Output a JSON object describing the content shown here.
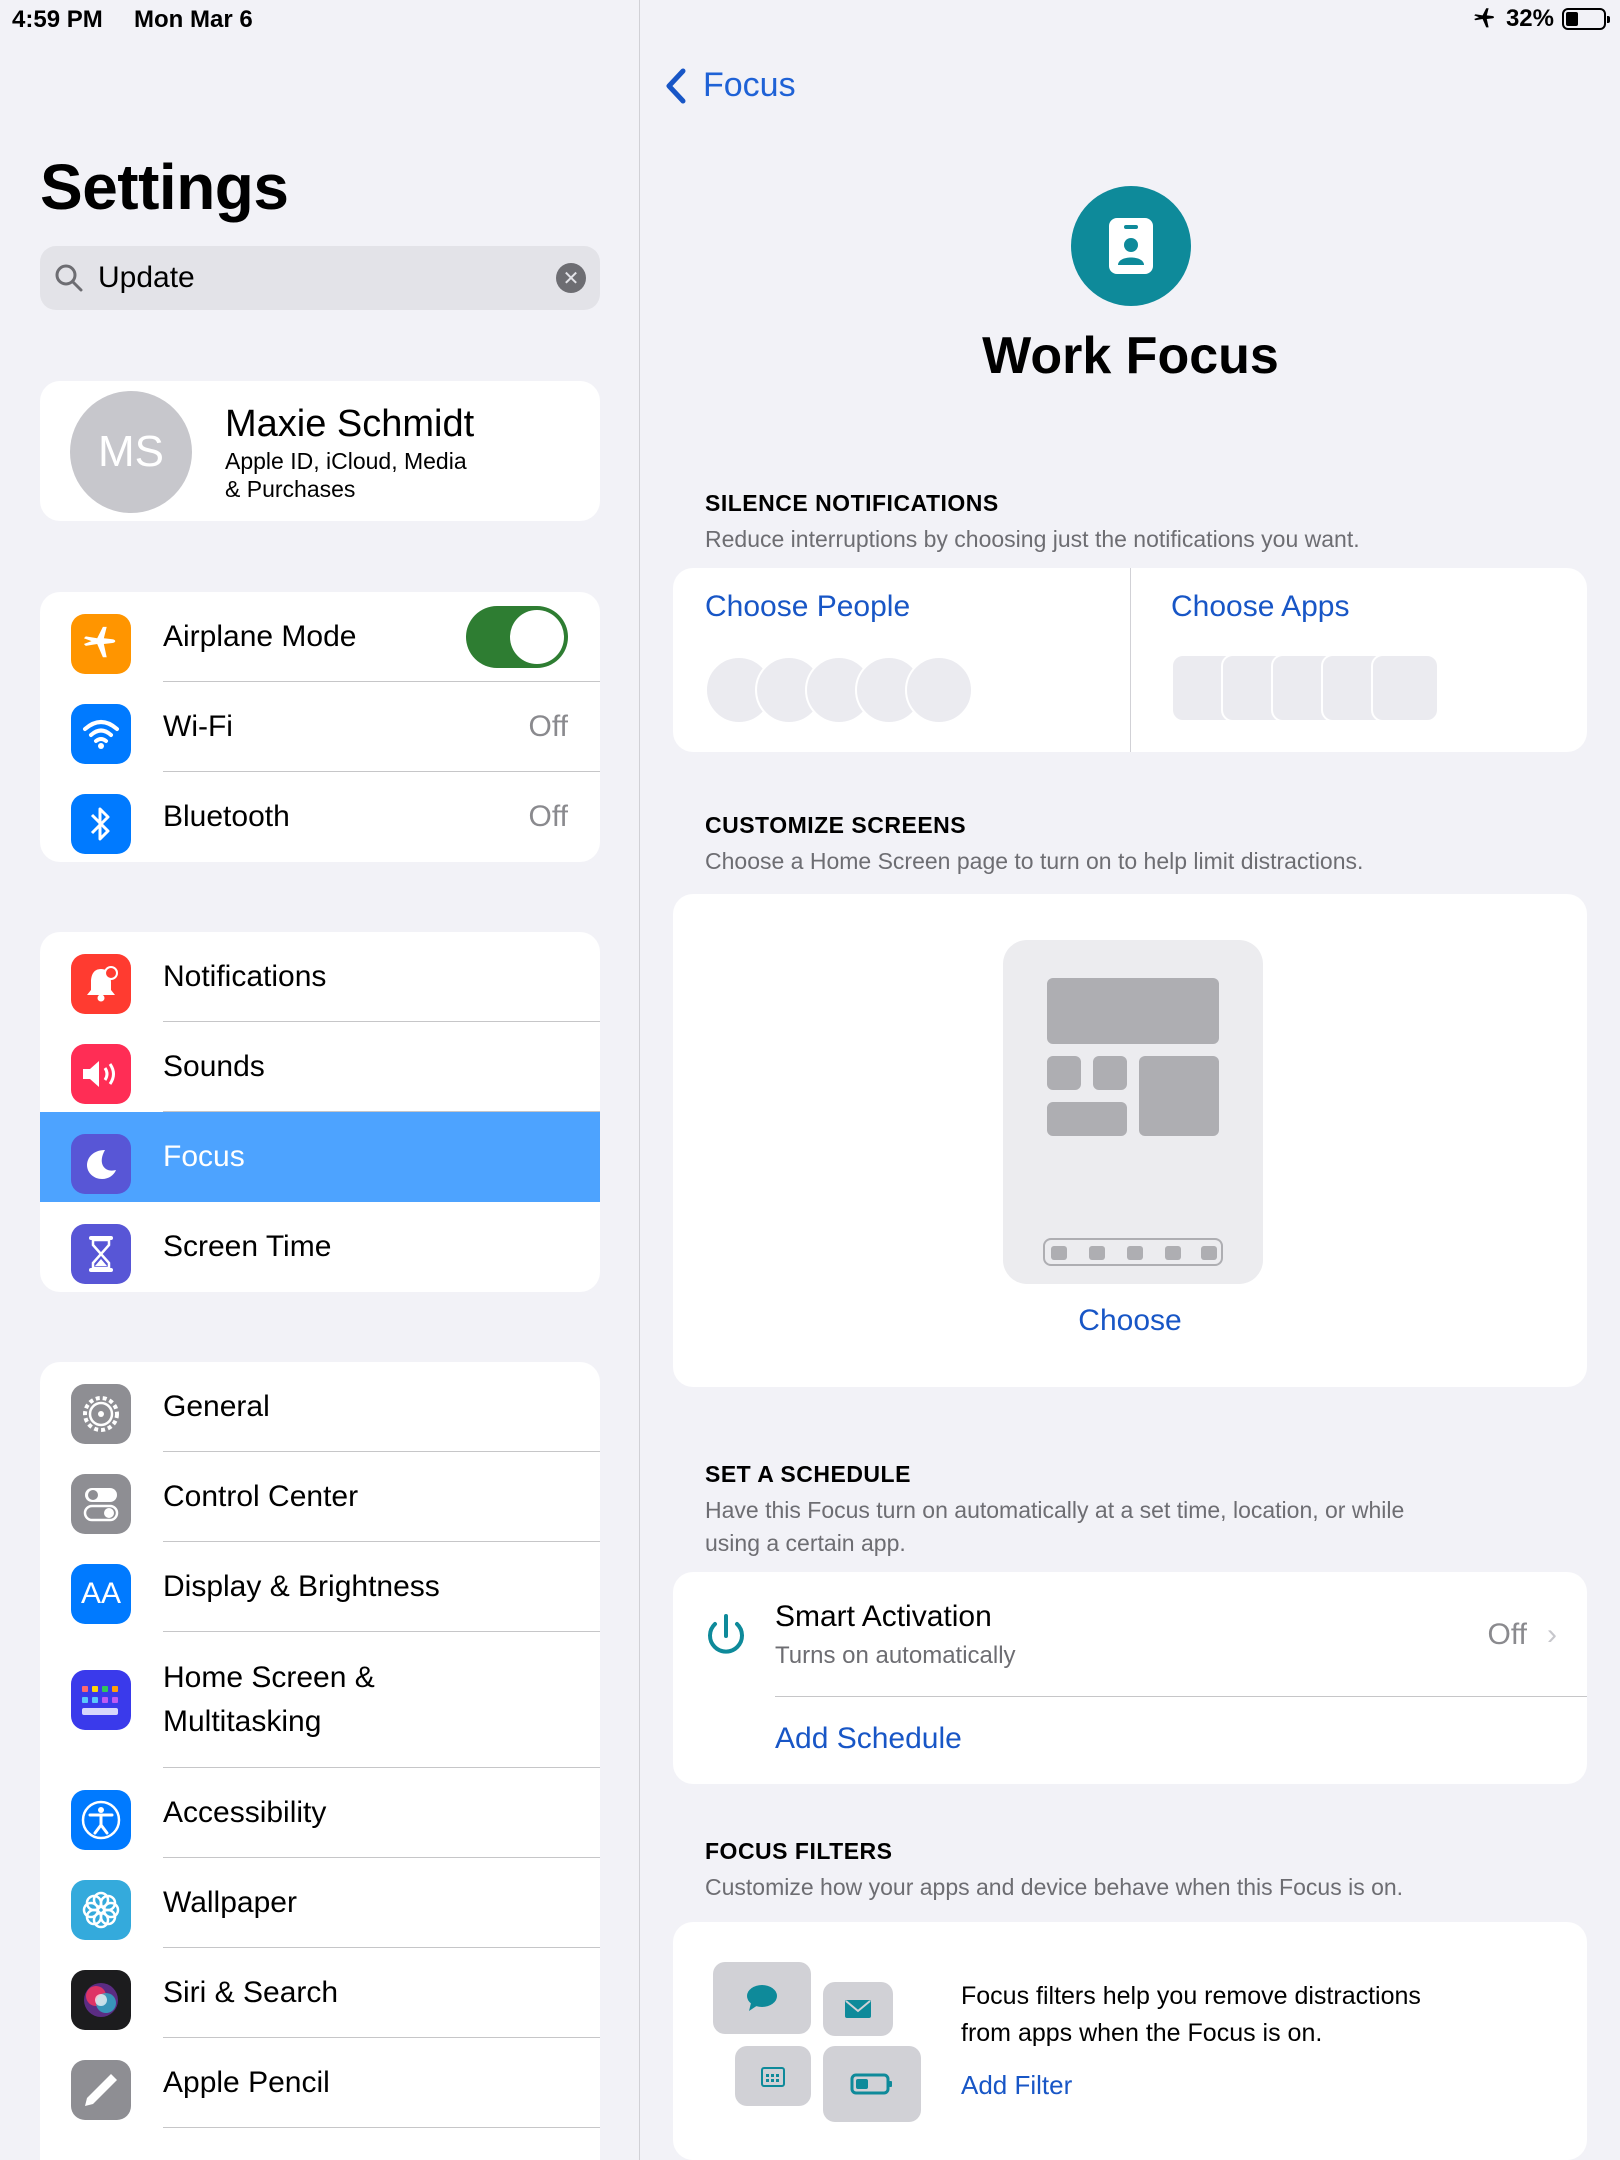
{
  "status": {
    "time": "4:59 PM",
    "date": "Mon Mar 6",
    "battery": "32%"
  },
  "sidebar": {
    "title": "Settings",
    "search_value": "Update",
    "account": {
      "initials": "MS",
      "name": "Maxie Schmidt",
      "subtitle_line1": "Apple ID, iCloud, Media",
      "subtitle_line2": "& Purchases"
    },
    "group1": [
      {
        "label": "Airplane Mode",
        "icon": "airplane-icon",
        "color": "#ff9500",
        "toggle": true
      },
      {
        "label": "Wi-Fi",
        "icon": "wifi-icon",
        "color": "#007aff",
        "value": "Off"
      },
      {
        "label": "Bluetooth",
        "icon": "bluetooth-icon",
        "color": "#007aff",
        "value": "Off"
      }
    ],
    "group2": [
      {
        "label": "Notifications",
        "icon": "bell-icon",
        "color": "#ff3b30"
      },
      {
        "label": "Sounds",
        "icon": "speaker-icon",
        "color": "#ff2d55"
      },
      {
        "label": "Focus",
        "icon": "moon-icon",
        "color": "#5856d6",
        "selected": true
      },
      {
        "label": "Screen Time",
        "icon": "hourglass-icon",
        "color": "#5856d6"
      }
    ],
    "group3": [
      {
        "label": "General",
        "icon": "gear-icon",
        "color": "#8e8e93"
      },
      {
        "label": "Control Center",
        "icon": "switches-icon",
        "color": "#8e8e93"
      },
      {
        "label": "Display & Brightness",
        "icon": "text-size-icon",
        "color": "#007aff"
      },
      {
        "label_line1": "Home Screen &",
        "label_line2": "Multitasking",
        "icon": "app-grid-icon",
        "color": "#3a3aeb"
      },
      {
        "label": "Accessibility",
        "icon": "accessibility-icon",
        "color": "#007aff"
      },
      {
        "label": "Wallpaper",
        "icon": "flower-icon",
        "color": "#34aadc"
      },
      {
        "label": "Siri & Search",
        "icon": "siri-icon",
        "color": "#1c1c1e"
      },
      {
        "label": "Apple Pencil",
        "icon": "pencil-icon",
        "color": "#8e8e93"
      }
    ]
  },
  "detail": {
    "back_label": "Focus",
    "title": "Work Focus",
    "accent": "#0e8a9a",
    "silence": {
      "heading": "SILENCE NOTIFICATIONS",
      "desc": "Reduce interruptions by choosing just the notifications you want.",
      "people": "Choose People",
      "apps": "Choose Apps"
    },
    "screens": {
      "heading": "CUSTOMIZE SCREENS",
      "desc": "Choose a Home Screen page to turn on to help limit distractions.",
      "choose": "Choose"
    },
    "schedule": {
      "heading": "SET A SCHEDULE",
      "desc_line1": "Have this Focus turn on automatically at a set time, location, or while",
      "desc_line2": "using a certain app.",
      "smart_title": "Smart Activation",
      "smart_sub": "Turns on automatically",
      "smart_value": "Off",
      "add": "Add Schedule"
    },
    "filters": {
      "heading": "FOCUS FILTERS",
      "desc": "Customize how your apps and device behave when this Focus is on.",
      "text_line1": "Focus filters help you remove distractions",
      "text_line2": "from apps when the Focus is on.",
      "add": "Add Filter"
    }
  }
}
